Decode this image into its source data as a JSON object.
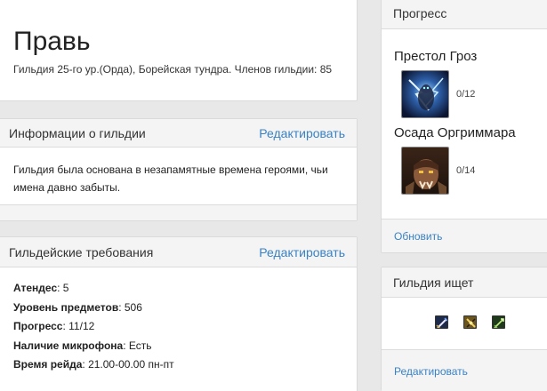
{
  "guild": {
    "name": "Правь",
    "subtitle": "Гильдия 25-го ур.(Орда), Борейская тундра. Членов гильдии: 85"
  },
  "info": {
    "heading": "Информации о гильдии",
    "edit_label": "Редактировать",
    "text": "Гильдия была основана в незапамятные времена героями, чьи имена давно забыты."
  },
  "requirements": {
    "heading": "Гильдейские требования",
    "edit_label": "Редактировать",
    "items": [
      {
        "label": "Атендес",
        "value": ": 5"
      },
      {
        "label": "Уровень предметов",
        "value": ": 506"
      },
      {
        "label": "Прогресс",
        "value": ": 11/12"
      },
      {
        "label": "Наличие микрофона",
        "value": ": Есть"
      },
      {
        "label": "Время рейда",
        "value": ": 21.00-00.00 пн-пт"
      }
    ]
  },
  "progress": {
    "heading": "Прогресс",
    "raids": [
      {
        "name": "Престол Гроз",
        "count": "0/12",
        "icon": "lightning-boss-icon"
      },
      {
        "name": "Осада Оргриммара",
        "count": "0/14",
        "icon": "orc-warchief-icon"
      }
    ],
    "refresh_label": "Обновить"
  },
  "seeking": {
    "heading": "Гильдия ищет",
    "classes": [
      "blade-class-icon",
      "shield-class-icon",
      "arrow-class-icon"
    ],
    "edit_label": "Редактировать"
  },
  "colors": {
    "link": "#3a82c4",
    "background": "#e8e8e8",
    "panel_header": "#f4f4f4"
  }
}
